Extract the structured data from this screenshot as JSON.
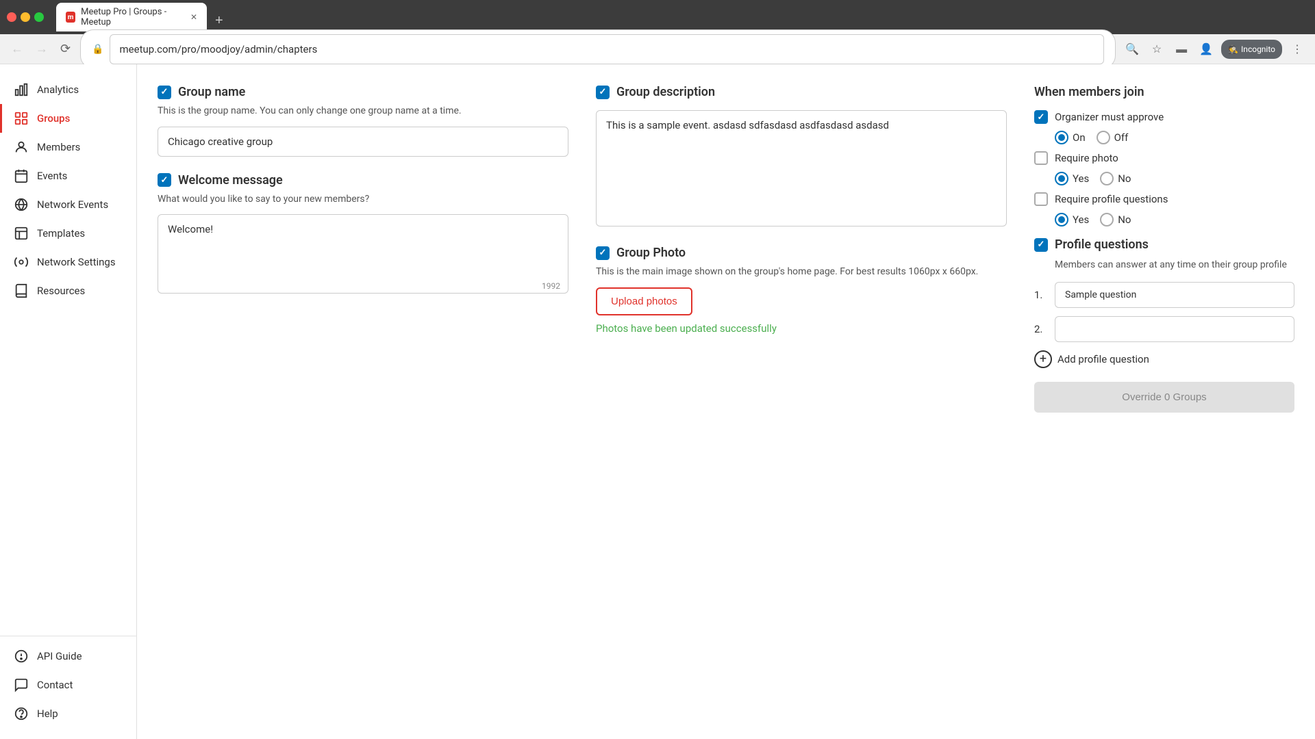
{
  "browser": {
    "tab_label": "Meetup Pro | Groups - Meetup",
    "tab_icon": "m",
    "address": "meetup.com/pro/moodjoy/admin/chapters",
    "new_tab_label": "+",
    "incognito_label": "Incognito"
  },
  "sidebar": {
    "items": [
      {
        "id": "analytics",
        "label": "Analytics",
        "icon": "chart"
      },
      {
        "id": "groups",
        "label": "Groups",
        "icon": "grid",
        "active": true
      },
      {
        "id": "members",
        "label": "Members",
        "icon": "person"
      },
      {
        "id": "events",
        "label": "Events",
        "icon": "calendar"
      },
      {
        "id": "network-events",
        "label": "Network Events",
        "icon": "globe"
      },
      {
        "id": "templates",
        "label": "Templates",
        "icon": "template"
      },
      {
        "id": "network-settings",
        "label": "Network Settings",
        "icon": "settings"
      },
      {
        "id": "resources",
        "label": "Resources",
        "icon": "resource"
      }
    ],
    "bottom_items": [
      {
        "id": "api-guide",
        "label": "API Guide",
        "icon": "api"
      },
      {
        "id": "contact",
        "label": "Contact",
        "icon": "contact"
      },
      {
        "id": "help",
        "label": "Help",
        "icon": "help"
      }
    ]
  },
  "group_name": {
    "title": "Group name",
    "description": "This is the group name. You can only change one group name at a time.",
    "value": "Chicago creative group",
    "checked": true
  },
  "welcome_message": {
    "title": "Welcome message",
    "description": "What would you like to say to your new members?",
    "value": "Welcome!",
    "char_count": "1992",
    "checked": true
  },
  "group_description": {
    "title": "Group description",
    "value": "This is a sample event. asdasd sdfasdasd asdfasdasd asdasd",
    "checked": true
  },
  "group_photo": {
    "title": "Group Photo",
    "description": "This is the main image shown on the group's home page. For best results 1060px x 660px.",
    "upload_label": "Upload photos",
    "success_message": "Photos have been updated successfully",
    "checked": true
  },
  "when_members_join": {
    "title": "When members join",
    "organizer_approve": {
      "label": "Organizer must approve",
      "checked": true
    },
    "on_off": {
      "on_label": "On",
      "off_label": "Off",
      "selected": "on"
    },
    "require_photo": {
      "label": "Require photo",
      "checked": false
    },
    "require_photo_yes_no": {
      "yes_label": "Yes",
      "no_label": "No",
      "selected": "yes"
    },
    "require_profile_questions": {
      "label": "Require profile questions",
      "checked": false
    },
    "require_pq_yes_no": {
      "yes_label": "Yes",
      "no_label": "No",
      "selected": "yes"
    }
  },
  "profile_questions": {
    "title": "Profile questions",
    "checked": true,
    "description": "Members can answer at any time on their group profile",
    "questions": [
      {
        "number": "1.",
        "value": "Sample question",
        "placeholder": ""
      },
      {
        "number": "2.",
        "value": "",
        "placeholder": ""
      }
    ],
    "add_label": "Add profile question",
    "override_label": "Override 0 Groups"
  }
}
